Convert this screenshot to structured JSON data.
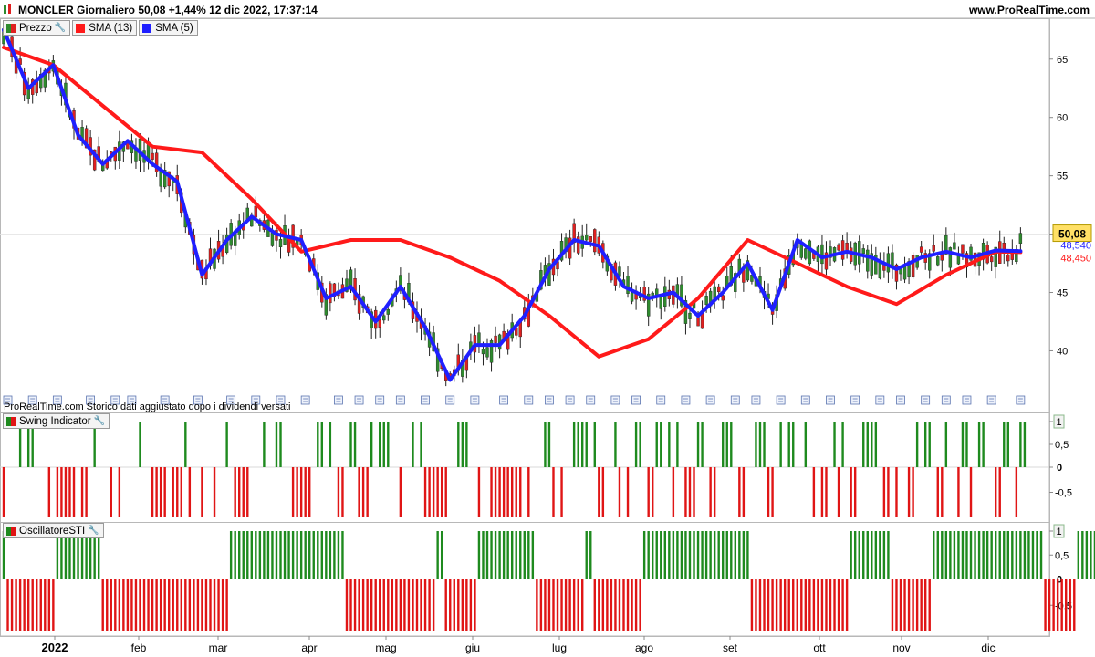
{
  "header": {
    "title": "MONCLER Giornaliero 50,08 +1,44% 12 dic 2022, 17:37:14",
    "site": "www.ProRealTime.com"
  },
  "legend_main": [
    {
      "label": "Prezzo",
      "color": "#2e8b2e",
      "icon": "wrench-icon"
    },
    {
      "label": "SMA (13)",
      "color": "#ff1a1a"
    },
    {
      "label": "SMA (5)",
      "color": "#1f1fff"
    }
  ],
  "legend_swing": {
    "label": "Swing Indicator",
    "icon": "wrench-icon"
  },
  "legend_osc": {
    "label": "OscillatoreSTI",
    "icon": "wrench-icon"
  },
  "note": "ProRealTime.com Storico dati aggiustato dopo i dividendi versati",
  "price_labels": {
    "last": "50,08",
    "sma5": "48,540",
    "sma13": "48,450"
  },
  "chart_data": [
    {
      "type": "line",
      "title": "MONCLER Giornaliero",
      "x_ticks": [
        "2022",
        "feb",
        "mar",
        "apr",
        "mag",
        "giu",
        "lug",
        "ago",
        "set",
        "ott",
        "nov",
        "dic"
      ],
      "y_ticks": [
        40,
        45,
        50,
        55,
        60,
        65
      ],
      "ylim": [
        35.5,
        68.5
      ],
      "series": [
        {
          "name": "SMA (13)",
          "color": "#ff1a1a",
          "x": [
            0,
            12,
            24,
            36,
            48,
            60,
            72,
            84,
            96,
            108,
            120,
            132,
            144,
            156,
            168,
            180,
            192,
            204,
            216,
            228,
            240,
            246
          ],
          "values": [
            66.0,
            64.5,
            61.0,
            57.5,
            57.0,
            53.0,
            48.5,
            49.5,
            49.5,
            48.0,
            46.0,
            43.0,
            39.5,
            41.0,
            44.5,
            49.5,
            47.5,
            45.5,
            44.0,
            46.5,
            48.5,
            48.45
          ]
        },
        {
          "name": "SMA (5)",
          "color": "#1f1fff",
          "x": [
            0,
            6,
            12,
            18,
            24,
            30,
            36,
            42,
            48,
            54,
            60,
            66,
            72,
            78,
            84,
            90,
            96,
            102,
            108,
            114,
            120,
            126,
            132,
            138,
            144,
            150,
            156,
            162,
            168,
            174,
            180,
            186,
            192,
            198,
            204,
            210,
            216,
            222,
            228,
            234,
            240,
            246
          ],
          "values": [
            67.5,
            62.5,
            64.5,
            58.5,
            56.0,
            58.0,
            56.0,
            54.5,
            46.5,
            49.5,
            51.5,
            50.0,
            49.5,
            44.5,
            45.5,
            42.5,
            45.5,
            42.0,
            37.5,
            40.5,
            40.5,
            43.0,
            47.0,
            49.5,
            49.0,
            45.5,
            44.5,
            45.0,
            43.0,
            45.0,
            47.5,
            43.5,
            49.5,
            48.0,
            48.5,
            48.0,
            47.0,
            48.0,
            48.5,
            48.0,
            48.6,
            48.54
          ]
        }
      ],
      "candles": {
        "count": 247,
        "up_color": "#2e8b2e",
        "down_color": "#e02020",
        "last_close": 50.08,
        "change": "+1,44%"
      },
      "y_axis_labels": [
        "40",
        "45",
        "50",
        "55",
        "60",
        "65"
      ]
    },
    {
      "type": "bar",
      "title": "Swing Indicator",
      "values": [
        1,
        0.5,
        0,
        -0.5
      ],
      "y_tick_labels": [
        "1",
        "0,5",
        "0",
        "-0,5"
      ],
      "ylim": [
        -1,
        1
      ],
      "pos_color": "#1e8a1e",
      "neg_color": "#e01515",
      "bars": [
        -1,
        0,
        0,
        0,
        1,
        0,
        1,
        1,
        0,
        0,
        0,
        -1,
        0,
        -1,
        -1,
        -1,
        -1,
        -1,
        0,
        -1,
        -1,
        0,
        1,
        0,
        0,
        0,
        -1,
        0,
        -1,
        0,
        0,
        0,
        0,
        1,
        0,
        0,
        -1,
        -1,
        -1,
        -1,
        0,
        -1,
        -1,
        -1,
        1,
        -1,
        0,
        0,
        -1,
        0,
        0,
        -1,
        0,
        0,
        1,
        0,
        -1,
        -1,
        -1,
        -1,
        0,
        0,
        0,
        1,
        0,
        0,
        1,
        1,
        0,
        0,
        -1,
        -1,
        -1,
        -1,
        -1,
        0,
        1,
        1,
        0,
        1,
        0,
        -1,
        -1,
        0,
        1,
        1,
        -1,
        -1,
        -1,
        1,
        0,
        1,
        1,
        1,
        0,
        0,
        -1,
        0,
        0,
        1,
        0,
        1,
        -1,
        -1,
        -1,
        -1,
        -1,
        -1,
        0,
        0,
        1,
        1,
        1,
        0,
        0,
        -1,
        0,
        0,
        -1,
        -1,
        -1,
        -1,
        -1,
        -1,
        -1,
        -1,
        0,
        -1,
        0,
        0,
        0,
        1,
        1,
        -1,
        0,
        -1,
        0,
        0,
        1,
        1,
        1,
        1,
        0,
        1,
        -1,
        -1,
        0,
        0,
        1,
        -1,
        0,
        -1,
        0,
        1,
        1,
        0,
        -1,
        -1,
        1,
        1,
        0,
        1,
        -1,
        1,
        0,
        -1,
        -1,
        -1,
        1,
        1,
        0,
        -1,
        -1,
        0,
        1,
        1,
        1,
        0,
        -1,
        -1,
        0,
        0,
        1,
        1,
        1,
        -1,
        -1,
        0,
        1,
        0,
        1,
        1,
        0,
        0,
        1,
        0,
        -1,
        0,
        -1,
        -1,
        0,
        1,
        -1,
        1,
        0,
        -1,
        -1,
        0,
        1,
        1,
        1,
        1,
        0,
        -1,
        -1,
        0,
        -1,
        0,
        0,
        -1,
        -1,
        1,
        0,
        1,
        1,
        0,
        -1,
        -1,
        1,
        0,
        0,
        -1,
        1,
        1,
        -1,
        0,
        1,
        1,
        0,
        0,
        -1,
        -1,
        1,
        1,
        0,
        -1,
        1,
        1,
        0
      ]
    },
    {
      "type": "bar",
      "title": "OscillatoreSTI",
      "y_tick_labels": [
        "1",
        "0,5",
        "0",
        "-0,5"
      ],
      "ylim": [
        -1,
        1
      ],
      "pos_color": "#1e8a1e",
      "neg_color": "#e01515",
      "runs": [
        [
          1,
          1
        ],
        [
          -1,
          12
        ],
        [
          1,
          11
        ],
        [
          -1,
          31
        ],
        [
          1,
          28
        ],
        [
          -1,
          22
        ],
        [
          1,
          2
        ],
        [
          -1,
          8
        ],
        [
          1,
          14
        ],
        [
          -1,
          12
        ],
        [
          1,
          2
        ],
        [
          -1,
          12
        ],
        [
          1,
          26
        ],
        [
          -1,
          24
        ],
        [
          1,
          10
        ],
        [
          -1,
          10
        ],
        [
          1,
          27
        ],
        [
          -1,
          8
        ],
        [
          1,
          9
        ],
        [
          -1,
          10
        ],
        [
          1,
          1
        ],
        [
          -1,
          2
        ]
      ]
    }
  ]
}
